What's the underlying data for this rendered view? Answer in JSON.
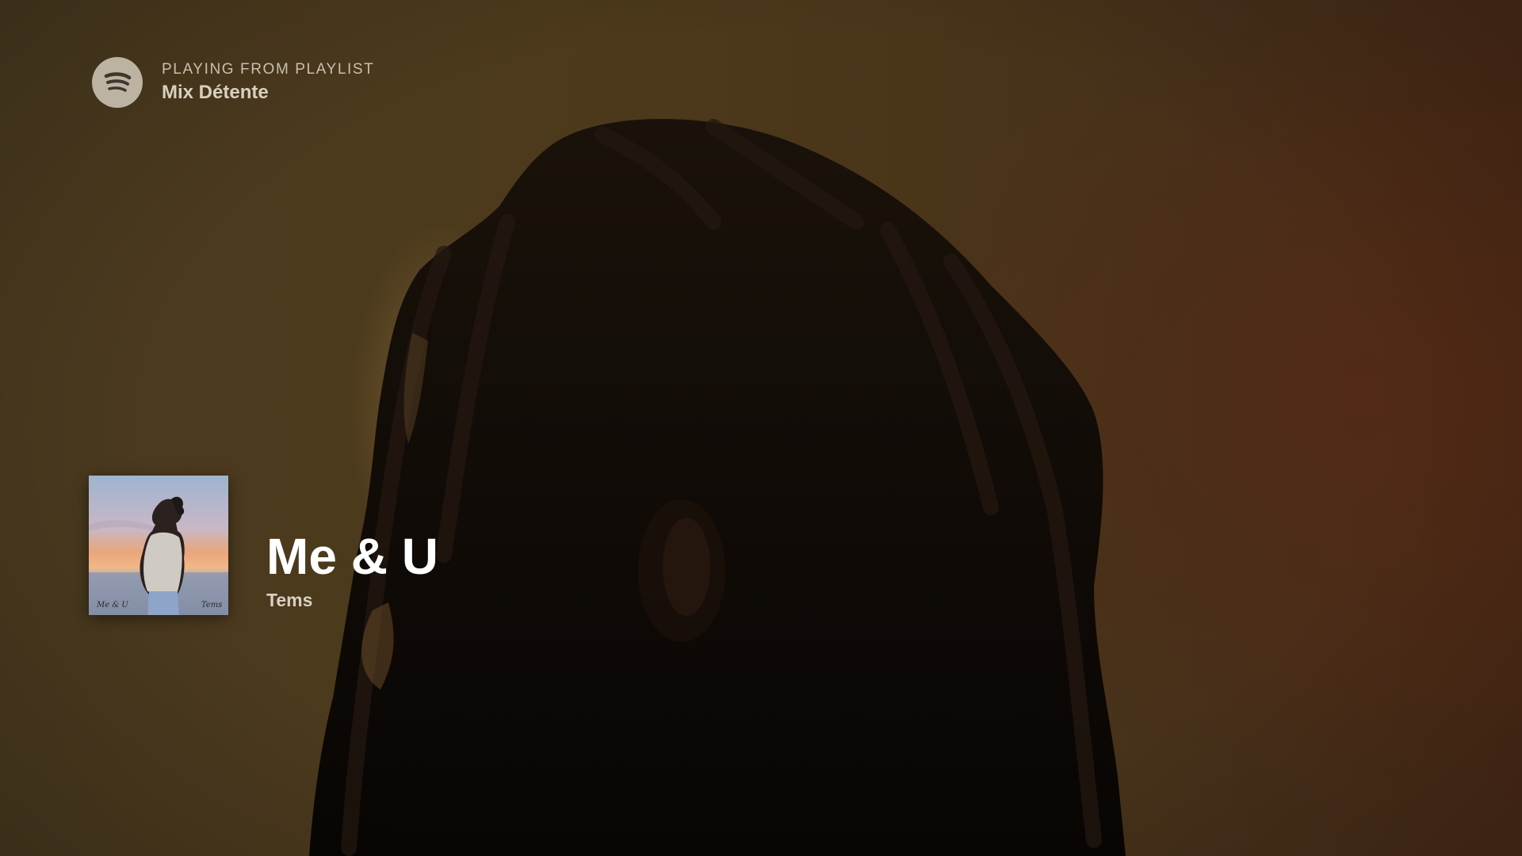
{
  "context": {
    "label": "PLAYING FROM PLAYLIST",
    "playlist_name": "Mix Détente"
  },
  "now_playing": {
    "title": "Me & U",
    "artist": "Tems",
    "cover_signature_left": "Me & U",
    "cover_signature_right": "Tems"
  },
  "icons": {
    "logo": "spotify-logo-icon"
  },
  "colors": {
    "background": "#4a3a1f",
    "title": "#ffffff",
    "subtext": "#c9bfae"
  }
}
